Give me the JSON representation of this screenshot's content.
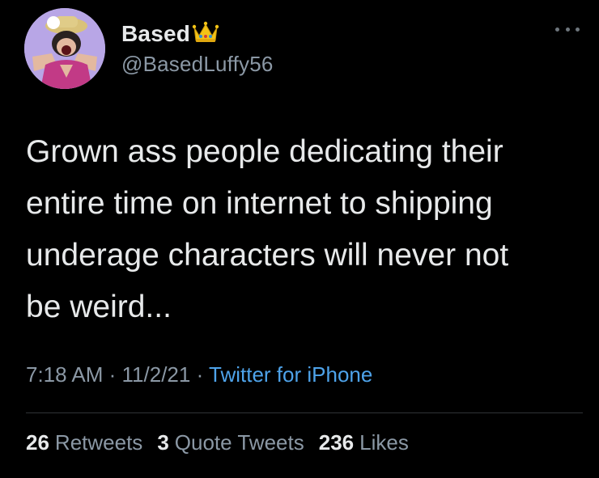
{
  "tweet": {
    "display_name": "Based",
    "handle": "@BasedLuffy56",
    "text_lines": [
      "Grown ass people dedicating their",
      "entire time on internet to shipping",
      "underage characters will never not",
      "be weird..."
    ],
    "time": "7:18 AM",
    "date": "11/2/21",
    "separator": "·",
    "source": "Twitter for iPhone",
    "stats": {
      "retweets_count": "26",
      "retweets_label": "Retweets",
      "quotes_count": "3",
      "quotes_label": "Quote Tweets",
      "likes_count": "236",
      "likes_label": "Likes"
    }
  },
  "icons": {
    "crown": "crown-emoji-icon",
    "more": "more-horizontal-icon",
    "avatar": "profile-avatar"
  },
  "colors": {
    "background": "#000000",
    "primary_text": "#e7e9ea",
    "secondary_text": "#8b98a5",
    "link": "#4ea3ea",
    "divider": "#2f3336"
  }
}
